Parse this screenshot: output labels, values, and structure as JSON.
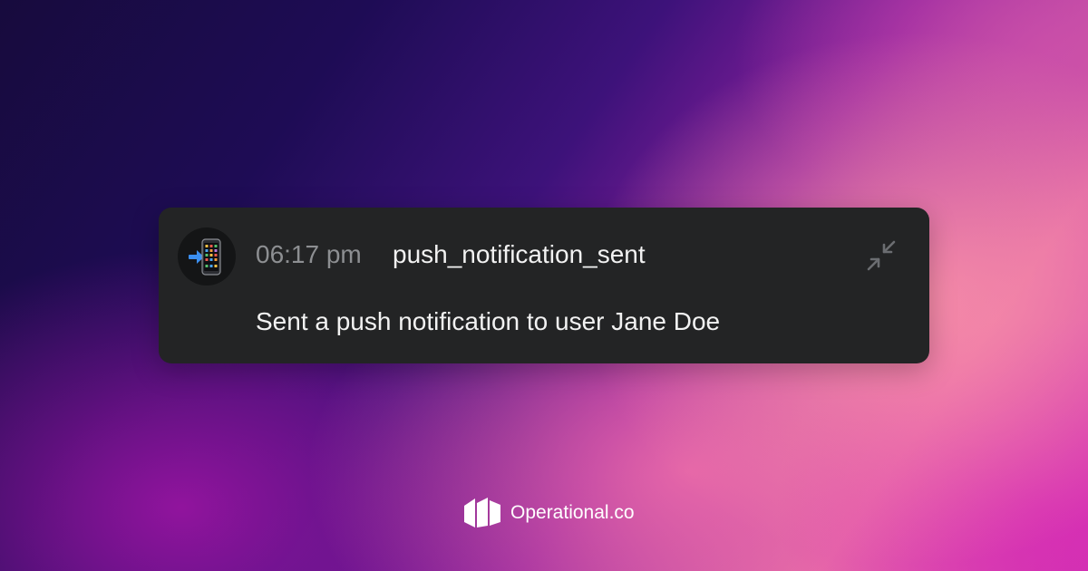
{
  "event": {
    "emoji_icon": "mobile-phone-with-arrow-icon",
    "time": "06:17 pm",
    "name": "push_notification_sent",
    "message": "Sent a push notification to user Jane Doe",
    "collapse_icon": "collapse-arrows-icon"
  },
  "brand": {
    "logo_icon": "operational-logo-icon",
    "name": "Operational.co"
  },
  "colors": {
    "card_background": "#232425",
    "time_text": "#8d8f92",
    "primary_text": "#f2f2f2"
  }
}
